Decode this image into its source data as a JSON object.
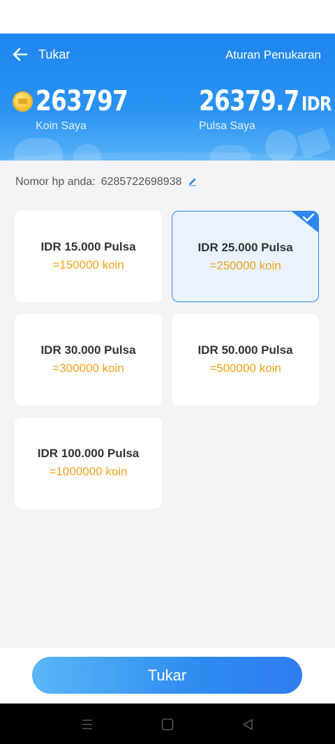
{
  "header": {
    "title": "Tukar",
    "rules_link": "Aturan Penukaran",
    "coins": {
      "value": "263797",
      "label": "Koin Saya"
    },
    "pulsa": {
      "value": "26379.7",
      "unit": "IDR",
      "label": "Pulsa Saya"
    }
  },
  "phone": {
    "label": "Nomor hp anda:",
    "number": "6285722698938"
  },
  "options": [
    {
      "title": "IDR 15.000 Pulsa",
      "coins": "=150000 koin",
      "selected": false
    },
    {
      "title": "IDR 25.000 Pulsa",
      "coins": "=250000 koin",
      "selected": true
    },
    {
      "title": "IDR 30.000 Pulsa",
      "coins": "=300000 koin",
      "selected": false
    },
    {
      "title": "IDR 50.000 Pulsa",
      "coins": "=500000 koin",
      "selected": false
    },
    {
      "title": "IDR 100.000 Pulsa",
      "coins": "=1000000 koin",
      "selected": false
    }
  ],
  "submit_label": "Tukar",
  "icons": {
    "back": "arrow-left-icon",
    "coin": "coin-icon",
    "edit": "pencil-icon",
    "check": "checkmark-icon",
    "nav": [
      "menu-icon",
      "home-square-icon",
      "back-triangle-icon"
    ]
  },
  "colors": {
    "primary": "#2a8cf0",
    "coin_text": "#f0a21a",
    "selected_bg": "#eaf3ff"
  }
}
